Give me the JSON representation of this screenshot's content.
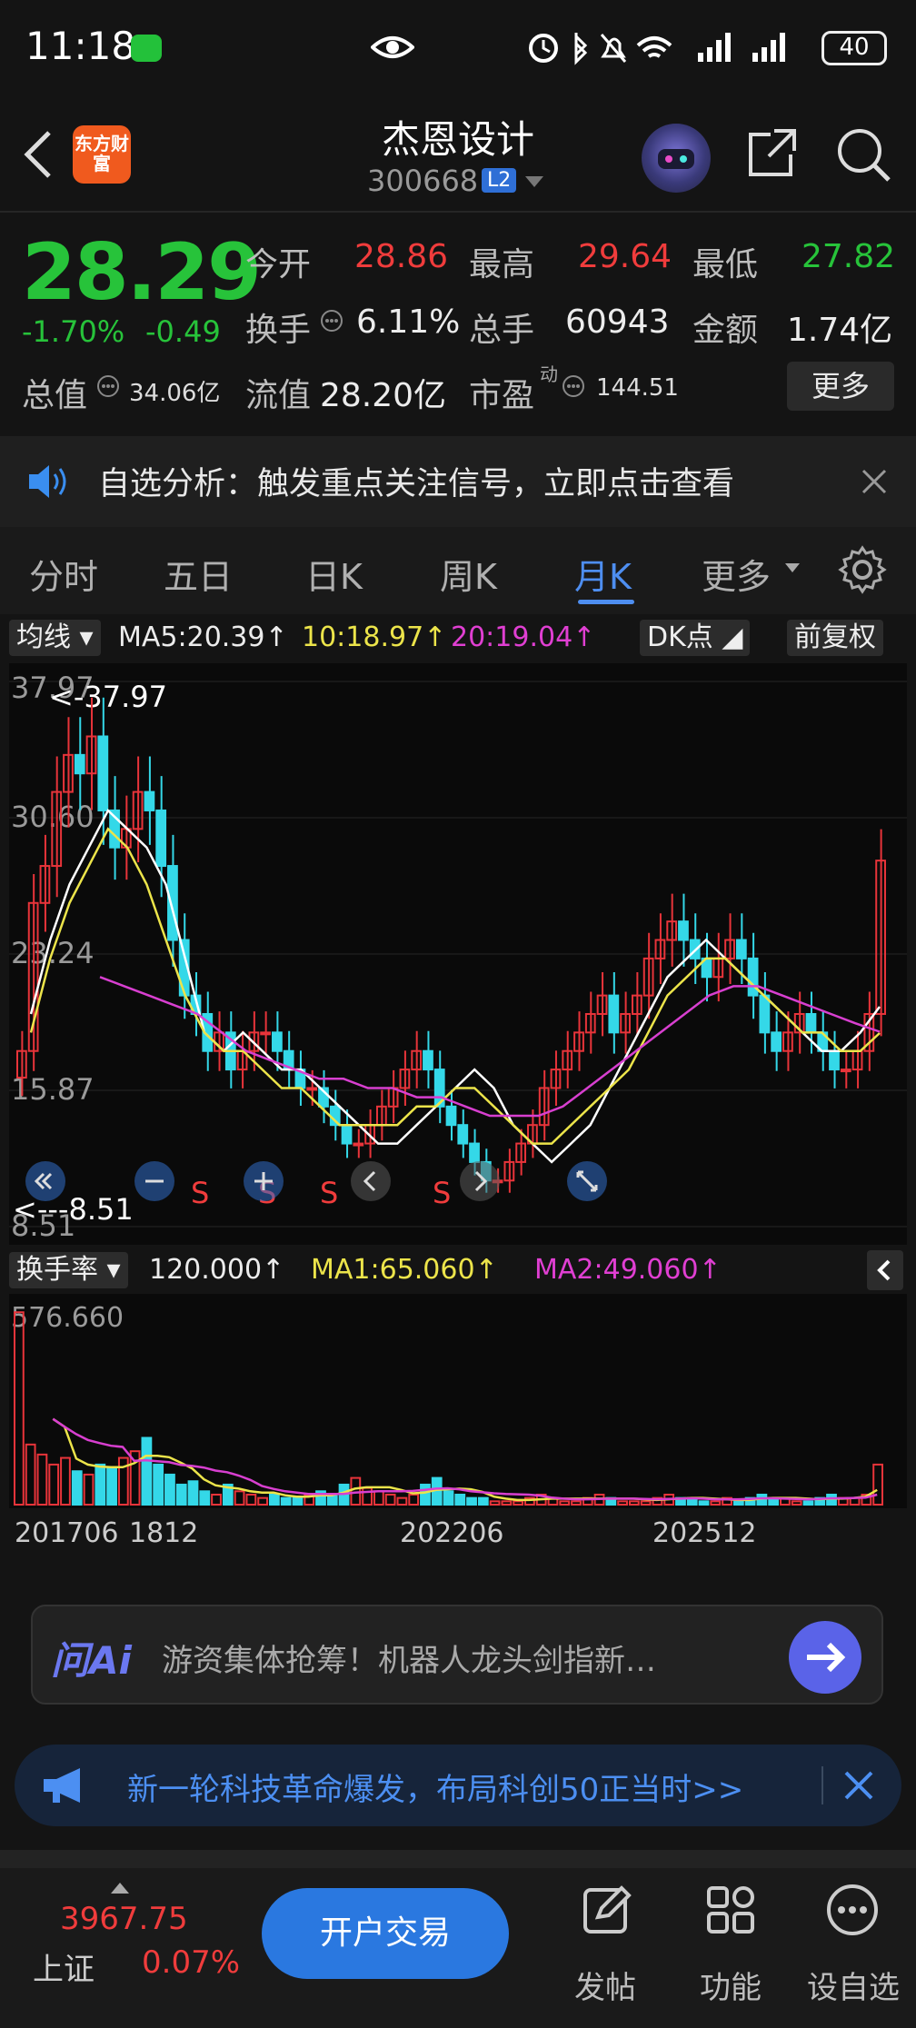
{
  "status_bar": {
    "time": "11:18",
    "battery": "40"
  },
  "header": {
    "logo_text": "东方财富",
    "stock_name": "杰恩设计",
    "stock_code": "300668",
    "level_badge": "L2"
  },
  "quote": {
    "price": "28.29",
    "change_pct": "-1.70%",
    "change": "-0.49",
    "open_label": "今开",
    "open": "28.86",
    "high_label": "最高",
    "high": "29.64",
    "low_label": "最低",
    "low": "27.82",
    "turnover_label": "换手",
    "turnover": "6.11%",
    "volume_label": "总手",
    "volume": "60943",
    "amount_label": "金额",
    "amount": "1.74亿",
    "mktcap_label": "总值",
    "mktcap": "34.06亿",
    "float_label": "流值",
    "float_cap": "28.20亿",
    "pe_label": "市盈",
    "pe_sup": "动",
    "pe": "144.51",
    "more_label": "更多"
  },
  "notice": {
    "text": "自选分析：触发重点关注信号，立即点击查看"
  },
  "tabs": [
    {
      "label": "分时"
    },
    {
      "label": "五日"
    },
    {
      "label": "日K"
    },
    {
      "label": "周K"
    },
    {
      "label": "月K"
    },
    {
      "label": "更多"
    }
  ],
  "ma_bar": {
    "selector": "均线",
    "ma5": "MA5:20.39↑",
    "ma10": "10:18.97↑",
    "ma20": "20:19.04↑",
    "dk": "DK点",
    "adjust": "前复权"
  },
  "chart_data": {
    "type": "candlestick",
    "period": "monthly",
    "y_ticks": [
      "37.97",
      "30.60",
      "23.24",
      "15.87",
      "8.51"
    ],
    "ylim": [
      8.51,
      37.97
    ],
    "max_marker": "<-37.97",
    "min_marker": "<---8.51",
    "signal_labels": [
      "S",
      "S",
      "S",
      "S"
    ],
    "colors": {
      "up": "#e8343a",
      "down": "#34d8e8",
      "ma5": "#ffffff",
      "ma10": "#ece44a",
      "ma20": "#d83fd0"
    },
    "close": [
      18,
      26,
      28,
      32,
      34,
      33,
      35,
      31,
      29,
      30,
      32,
      31,
      28,
      24,
      21,
      20,
      18,
      19,
      17,
      18,
      19,
      19,
      18,
      17,
      16,
      16,
      15,
      14,
      13,
      13,
      14,
      15,
      16,
      17,
      18,
      17,
      15,
      14,
      13,
      12,
      11,
      11,
      12,
      13,
      14,
      16,
      17,
      18,
      19,
      20,
      21,
      19,
      20,
      21,
      23,
      24,
      25,
      24,
      23,
      22,
      23,
      24,
      23,
      21,
      19,
      18,
      19,
      20,
      19,
      18,
      17,
      17,
      18,
      20,
      28.29
    ],
    "ma_series": [
      {
        "name": "MA5",
        "values": [
          20,
          24,
          27,
          29,
          31,
          30,
          29,
          27,
          23,
          19,
          18,
          19,
          18,
          17,
          17,
          16,
          15,
          14,
          13,
          13,
          14,
          15,
          16,
          17,
          16,
          14,
          13,
          12,
          13,
          14,
          16,
          18,
          20,
          22,
          23,
          24,
          23,
          22,
          21,
          20,
          19,
          18,
          18,
          19,
          20.39
        ]
      },
      {
        "name": "MA10",
        "values": [
          19,
          23,
          26,
          28,
          30,
          29,
          27,
          24,
          21,
          19,
          18,
          18,
          17,
          16,
          16,
          15,
          14,
          14,
          14,
          14,
          15,
          15,
          16,
          16,
          15,
          14,
          13,
          13,
          14,
          15,
          16,
          17,
          19,
          21,
          22,
          23,
          23,
          22,
          21,
          20,
          19,
          19,
          18,
          18,
          18.97
        ]
      },
      {
        "name": "MA20",
        "values": [
          22,
          21.5,
          21,
          20.5,
          20,
          19,
          18,
          17.5,
          17,
          16.5,
          16.5,
          16,
          16,
          15.5,
          15.5,
          15,
          14.5,
          14.5,
          14.5,
          15,
          16,
          17,
          18,
          19,
          20,
          21,
          21.5,
          21.5,
          21,
          20.5,
          20,
          19.5,
          19.04
        ]
      }
    ]
  },
  "turnover_bar": {
    "selector": "换手率",
    "value": "120.000↑",
    "ma1": "MA1:65.060↑",
    "ma2": "MA2:49.060↑",
    "y_top": "576.660"
  },
  "turnover_data": [
    576,
    180,
    150,
    120,
    140,
    100,
    90,
    120,
    110,
    140,
    160,
    200,
    120,
    90,
    60,
    70,
    40,
    30,
    60,
    40,
    30,
    20,
    30,
    20,
    20,
    30,
    40,
    30,
    60,
    80,
    50,
    40,
    30,
    20,
    30,
    60,
    80,
    40,
    30,
    20,
    20,
    10,
    10,
    10,
    20,
    30,
    20,
    10,
    10,
    20,
    30,
    20,
    10,
    10,
    10,
    20,
    30,
    20,
    20,
    10,
    10,
    20,
    10,
    20,
    30,
    20,
    20,
    10,
    10,
    20,
    30,
    20,
    20,
    30,
    120
  ],
  "x_axis": [
    "201706",
    "1812",
    "202206",
    "202512"
  ],
  "ai_bar": {
    "logo": "问Ai",
    "text": "游资集体抢筹！机器人龙头剑指新…"
  },
  "promo": {
    "text": "新一轮科技革命爆发，布局科创50正当时>>"
  },
  "bottom_nav": {
    "index_value": "3967.75",
    "index_name": "上证",
    "index_pct": "0.07%",
    "trade_label": "开户交易",
    "post_label": "发帖",
    "func_label": "功能",
    "watch_label": "设自选"
  }
}
